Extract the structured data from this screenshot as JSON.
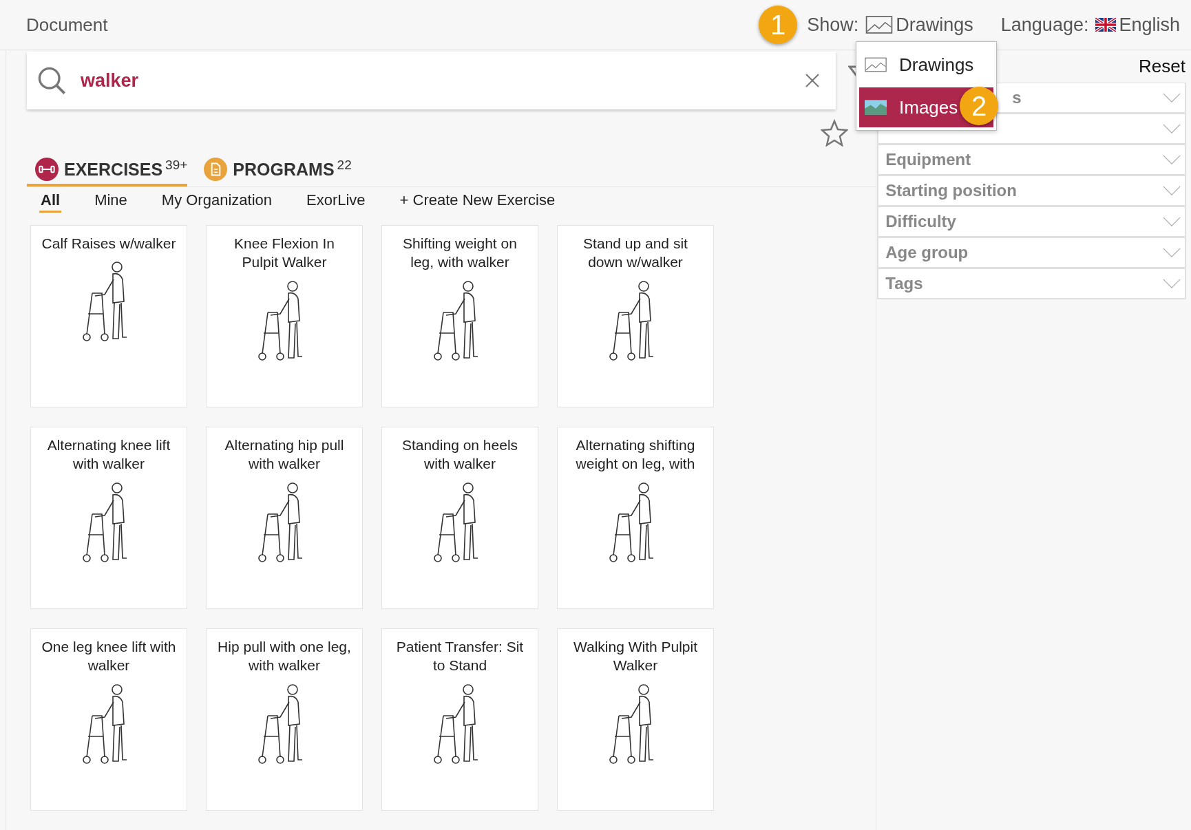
{
  "header": {
    "title": "Document",
    "show_label": "Show:",
    "show_value": "Drawings",
    "language_label": "Language:",
    "language_value": "English",
    "callout": "1"
  },
  "show_menu": {
    "callout": "2",
    "items": [
      {
        "label": "Drawings",
        "kind": "drawing",
        "selected": false
      },
      {
        "label": "Images",
        "kind": "image",
        "selected": true
      }
    ]
  },
  "search": {
    "value": "walker"
  },
  "tabs": [
    {
      "label": "EXERCISES",
      "count": "39+",
      "kind": "exercises",
      "selected": true
    },
    {
      "label": "PROGRAMS",
      "count": "22",
      "kind": "programs",
      "selected": false
    }
  ],
  "subtabs": [
    {
      "label": "All",
      "selected": true
    },
    {
      "label": "Mine",
      "selected": false
    },
    {
      "label": "My Organization",
      "selected": false
    },
    {
      "label": "ExorLive",
      "selected": false
    },
    {
      "label": "+ Create New Exercise",
      "selected": false
    }
  ],
  "filters": {
    "reset": "Reset",
    "items": [
      {
        "label": "s",
        "covered": true
      },
      {
        "covered": false
      },
      {
        "label": "Equipment",
        "covered": false
      },
      {
        "label": "Starting position",
        "covered": false
      },
      {
        "label": "Difficulty",
        "covered": false
      },
      {
        "label": "Age group",
        "covered": false
      },
      {
        "label": "Tags",
        "covered": false
      }
    ]
  },
  "exercises": [
    {
      "title": "Calf Raises w/walker"
    },
    {
      "title": "Knee Flexion In Pulpit Walker"
    },
    {
      "title": "Shifting weight on leg, with walker"
    },
    {
      "title": "Stand up and sit down w/walker"
    },
    {
      "title": "Alternating knee lift with walker"
    },
    {
      "title": "Alternating hip pull with walker"
    },
    {
      "title": "Standing on heels with walker"
    },
    {
      "title": "Alternating shifting weight on leg, with"
    },
    {
      "title": "One leg knee lift with walker"
    },
    {
      "title": "Hip pull with one leg, with walker"
    },
    {
      "title": "Patient Transfer: Sit to Stand"
    },
    {
      "title": "Walking With Pulpit Walker"
    }
  ]
}
